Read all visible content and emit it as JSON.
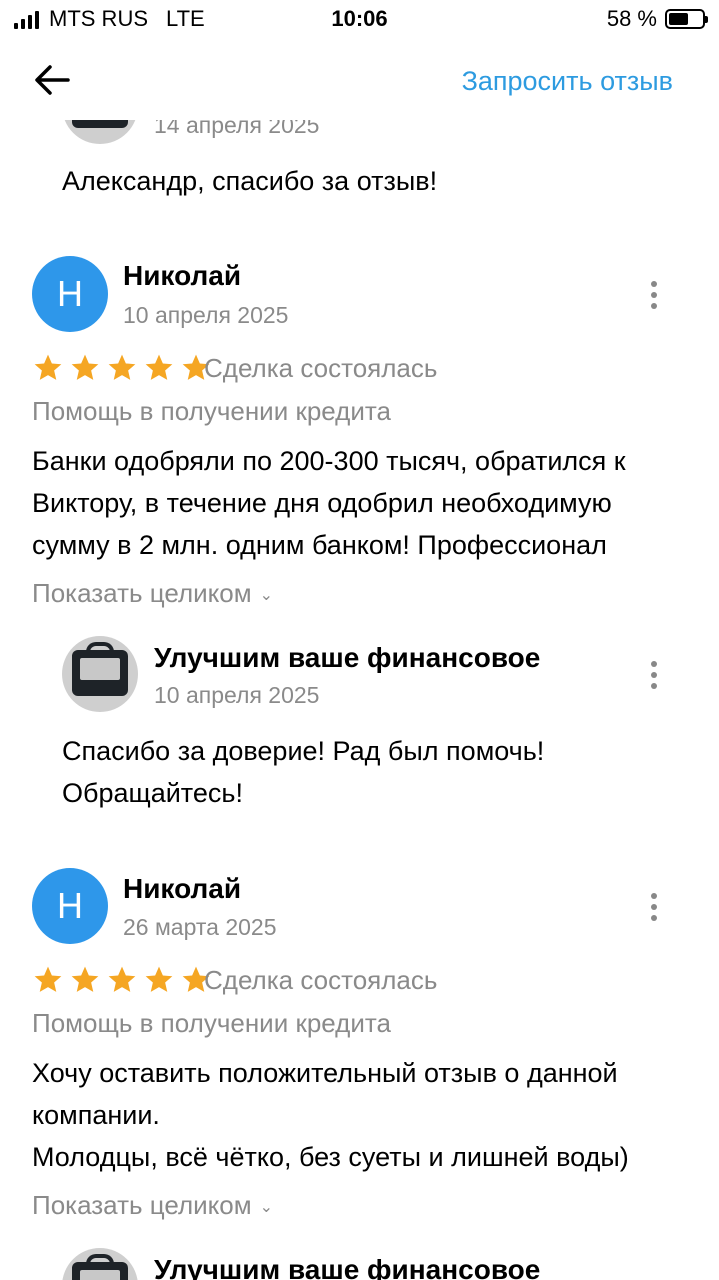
{
  "status": {
    "carrier": "MTS RUS",
    "network": "LTE",
    "time": "10:06",
    "battery": "58 %",
    "battery_level": 0.58
  },
  "header": {
    "request_label": "Запросить отзыв"
  },
  "top_reply": {
    "date": "14 апреля 2025",
    "text": "Александр, спасибо за отзыв!"
  },
  "reviews": [
    {
      "avatar_letter": "Н",
      "name": "Николай",
      "date": "10 апреля 2025",
      "rating": 5,
      "deal": "Сделка состоялась",
      "service": "Помощь в получении кредита",
      "lines": [
        "Банки одобряли по 200-300 тысяч, обратился к",
        "Виктору, в течение дня одобрил  необходимую",
        "сумму в 2 млн. одним банком! Профессионал"
      ],
      "show_more": "Показать целиком",
      "reply": {
        "name": "Улучшим ваше финансовое",
        "date": "10 апреля 2025",
        "lines": [
          "Спасибо за доверие! Рад был помочь!",
          "Обращайтесь!"
        ]
      }
    },
    {
      "avatar_letter": "Н",
      "name": "Николай",
      "date": "26 марта 2025",
      "rating": 5,
      "deal": "Сделка состоялась",
      "service": "Помощь в получении кредита",
      "lines": [
        "Хочу оставить положительный отзыв о  данной",
        "компании.",
        "Молодцы, всё чётко, без суеты и лишней воды)"
      ],
      "show_more": "Показать целиком",
      "reply": {
        "name": "Улучшим ваше финансовое"
      }
    }
  ],
  "colors": {
    "accent": "#2d9be0",
    "star": "#f5a623",
    "avatar": "#2e97ea",
    "muted": "#8a8a8a"
  },
  "icons": {
    "back": "arrow-left-icon",
    "more": "kebab-menu-icon",
    "star": "star-icon",
    "expand": "chevron-down-icon"
  }
}
